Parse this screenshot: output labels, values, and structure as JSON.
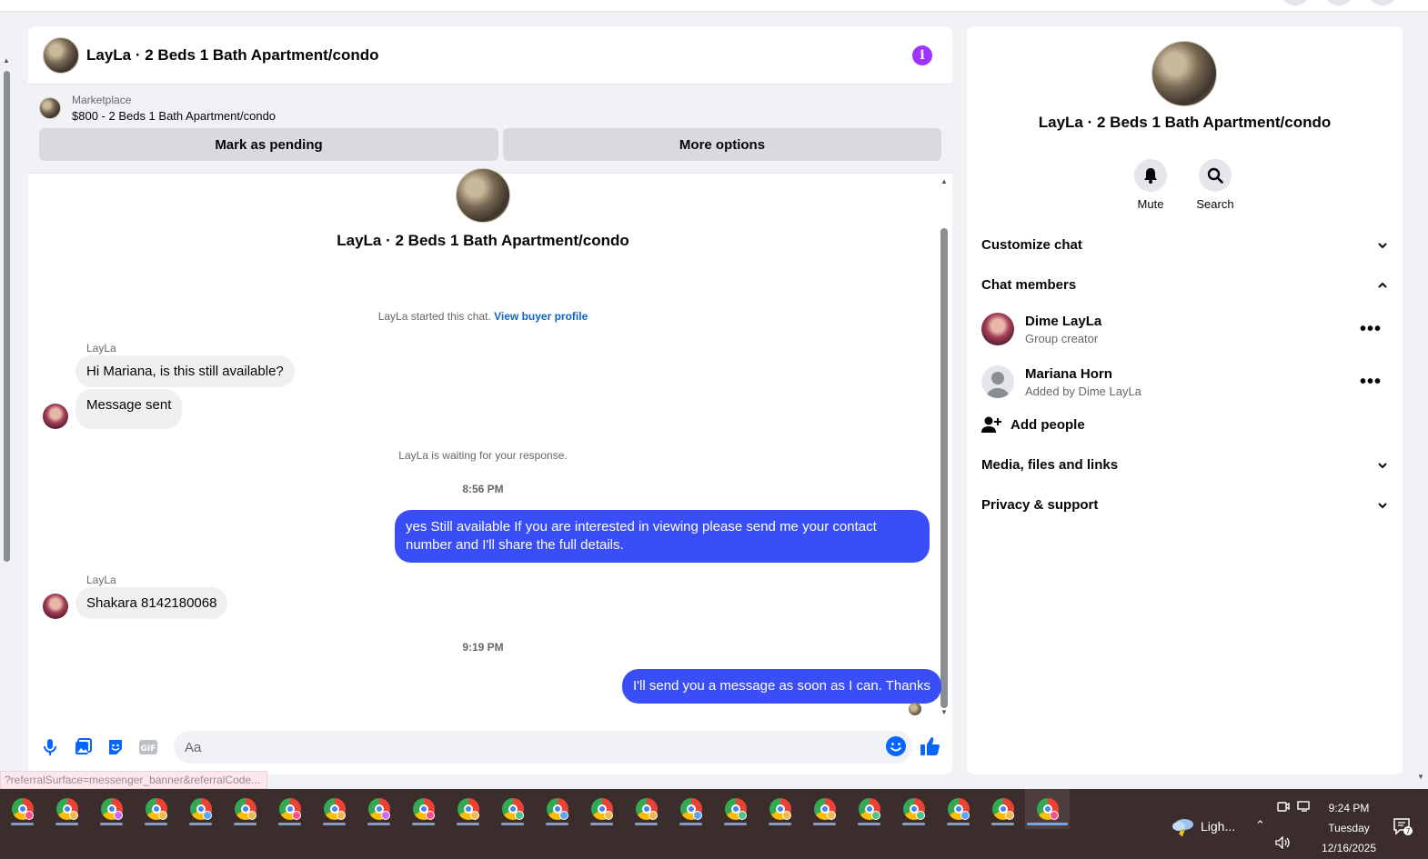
{
  "chat": {
    "title": "LayLa · 2 Beds 1 Bath Apartment/condo",
    "marketplace_label": "Marketplace",
    "marketplace_item": "$800 - 2 Beds 1 Bath Apartment/condo",
    "mark_pending": "Mark as pending",
    "more_options": "More options"
  },
  "thread": {
    "name": "LayLa · 2 Beds 1 Bath Apartment/condo",
    "started_text": "LayLa started this chat.",
    "view_profile": "View buyer profile",
    "messages": [
      {
        "sender": "LayLa",
        "text": "Hi Mariana, is this still available?"
      },
      {
        "text": "Message sent"
      },
      {
        "text": "yes Still available If you are interested in viewing please send me your contact number and I'll share the full details."
      },
      {
        "sender": "LayLa",
        "text": "Shakara 8142180068"
      },
      {
        "text": "I'll send you a message as soon as I can. Thanks"
      }
    ],
    "waiting": "LayLa is waiting for your response.",
    "time1": "8:56 PM",
    "time2": "9:19 PM"
  },
  "composer": {
    "placeholder": "Aa"
  },
  "status_url": "?referralSurface=messenger_banner&referralCode...",
  "details": {
    "name": "LayLa · 2 Beds 1 Bath Apartment/condo",
    "mute": "Mute",
    "search": "Search",
    "customize": "Customize chat",
    "members_header": "Chat members",
    "members": [
      {
        "name": "Dime LayLa",
        "role": "Group creator"
      },
      {
        "name": "Mariana Horn",
        "role": "Added by Dime LayLa"
      }
    ],
    "add_people": "Add people",
    "media": "Media, files and links",
    "privacy": "Privacy & support"
  },
  "taskbar": {
    "weather": "Ligh...",
    "time": "9:24 PM",
    "day": "Tuesday",
    "date": "12/16/2025",
    "notifications": "7",
    "badge_colors": [
      "#ff4f8b",
      "#f2b84b",
      "#c86cff",
      "#f2b84b",
      "#59a6ff",
      "#f2b84b",
      "#ff4f8b",
      "#f2b84b",
      "#c86cff",
      "#ff4f8b",
      "#f2b84b",
      "#4fc38a",
      "#59a6ff",
      "#f2b84b",
      "#f2b84b",
      "#59a6ff",
      "#4fc38a",
      "#f2b84b",
      "#f2b84b",
      "#4fc38a",
      "#4fc38a",
      "#59a6ff",
      "#f2b84b",
      "#ff4f8b"
    ]
  },
  "colors": {
    "accent": "#0866ff",
    "outgoing_bubble": "#3a4ef7",
    "info": "#a033ff"
  }
}
